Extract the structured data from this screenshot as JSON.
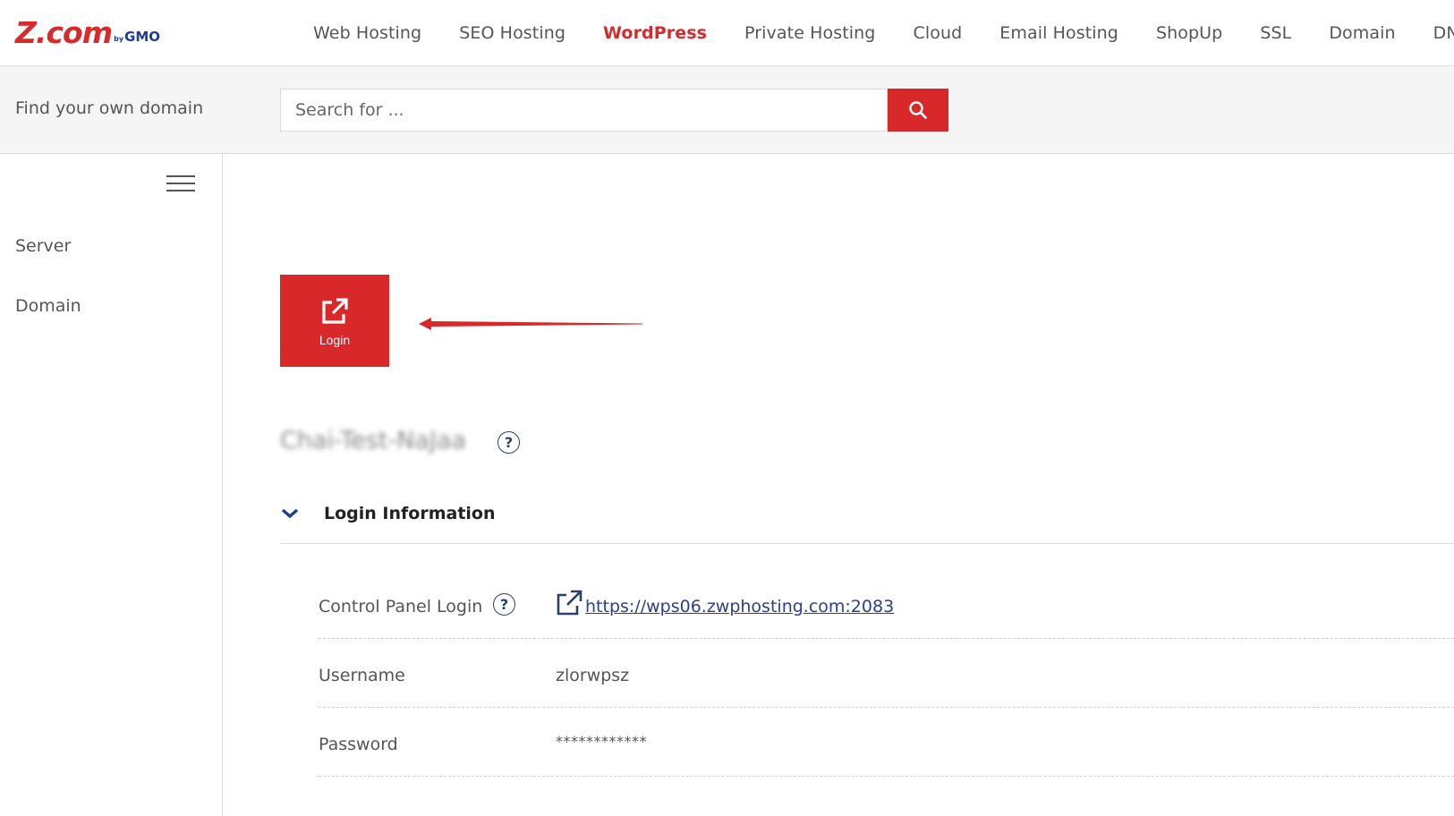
{
  "brand": {
    "logo_main": "Z.com",
    "logo_by": "by",
    "logo_gmo": "GMO",
    "accent_color": "#d9282a",
    "secondary_color": "#1f3e8a"
  },
  "nav": {
    "items": [
      {
        "label": "Web Hosting",
        "active": false
      },
      {
        "label": "SEO Hosting",
        "active": false
      },
      {
        "label": "WordPress",
        "active": true
      },
      {
        "label": "Private Hosting",
        "active": false
      },
      {
        "label": "Cloud",
        "active": false
      },
      {
        "label": "Email Hosting",
        "active": false
      },
      {
        "label": "ShopUp",
        "active": false
      },
      {
        "label": "SSL",
        "active": false
      },
      {
        "label": "Domain",
        "active": false
      },
      {
        "label": "DNS",
        "active": false
      }
    ]
  },
  "search": {
    "label": "Find your own domain",
    "placeholder": "Search for ...",
    "button_icon": "search-icon"
  },
  "sidebar": {
    "menu_icon": "hamburger-menu-icon",
    "items": [
      {
        "label": "Server"
      },
      {
        "label": "Domain"
      }
    ]
  },
  "main": {
    "login_tile": {
      "label": "Login",
      "icon": "external-link-icon"
    },
    "annotation_icon": "left-arrow-icon",
    "server_name": "Chai-Test-NaJaa",
    "help_icon": "question-circle-icon",
    "section": {
      "title": "Login Information",
      "toggle_icon": "chevron-down-icon",
      "rows": [
        {
          "label": "Control Panel Login",
          "value": "https://wps06.zwphosting.com:2083"
        },
        {
          "label": "Username",
          "value": "zlorwpsz"
        },
        {
          "label": "Password",
          "value": "************"
        }
      ]
    }
  }
}
